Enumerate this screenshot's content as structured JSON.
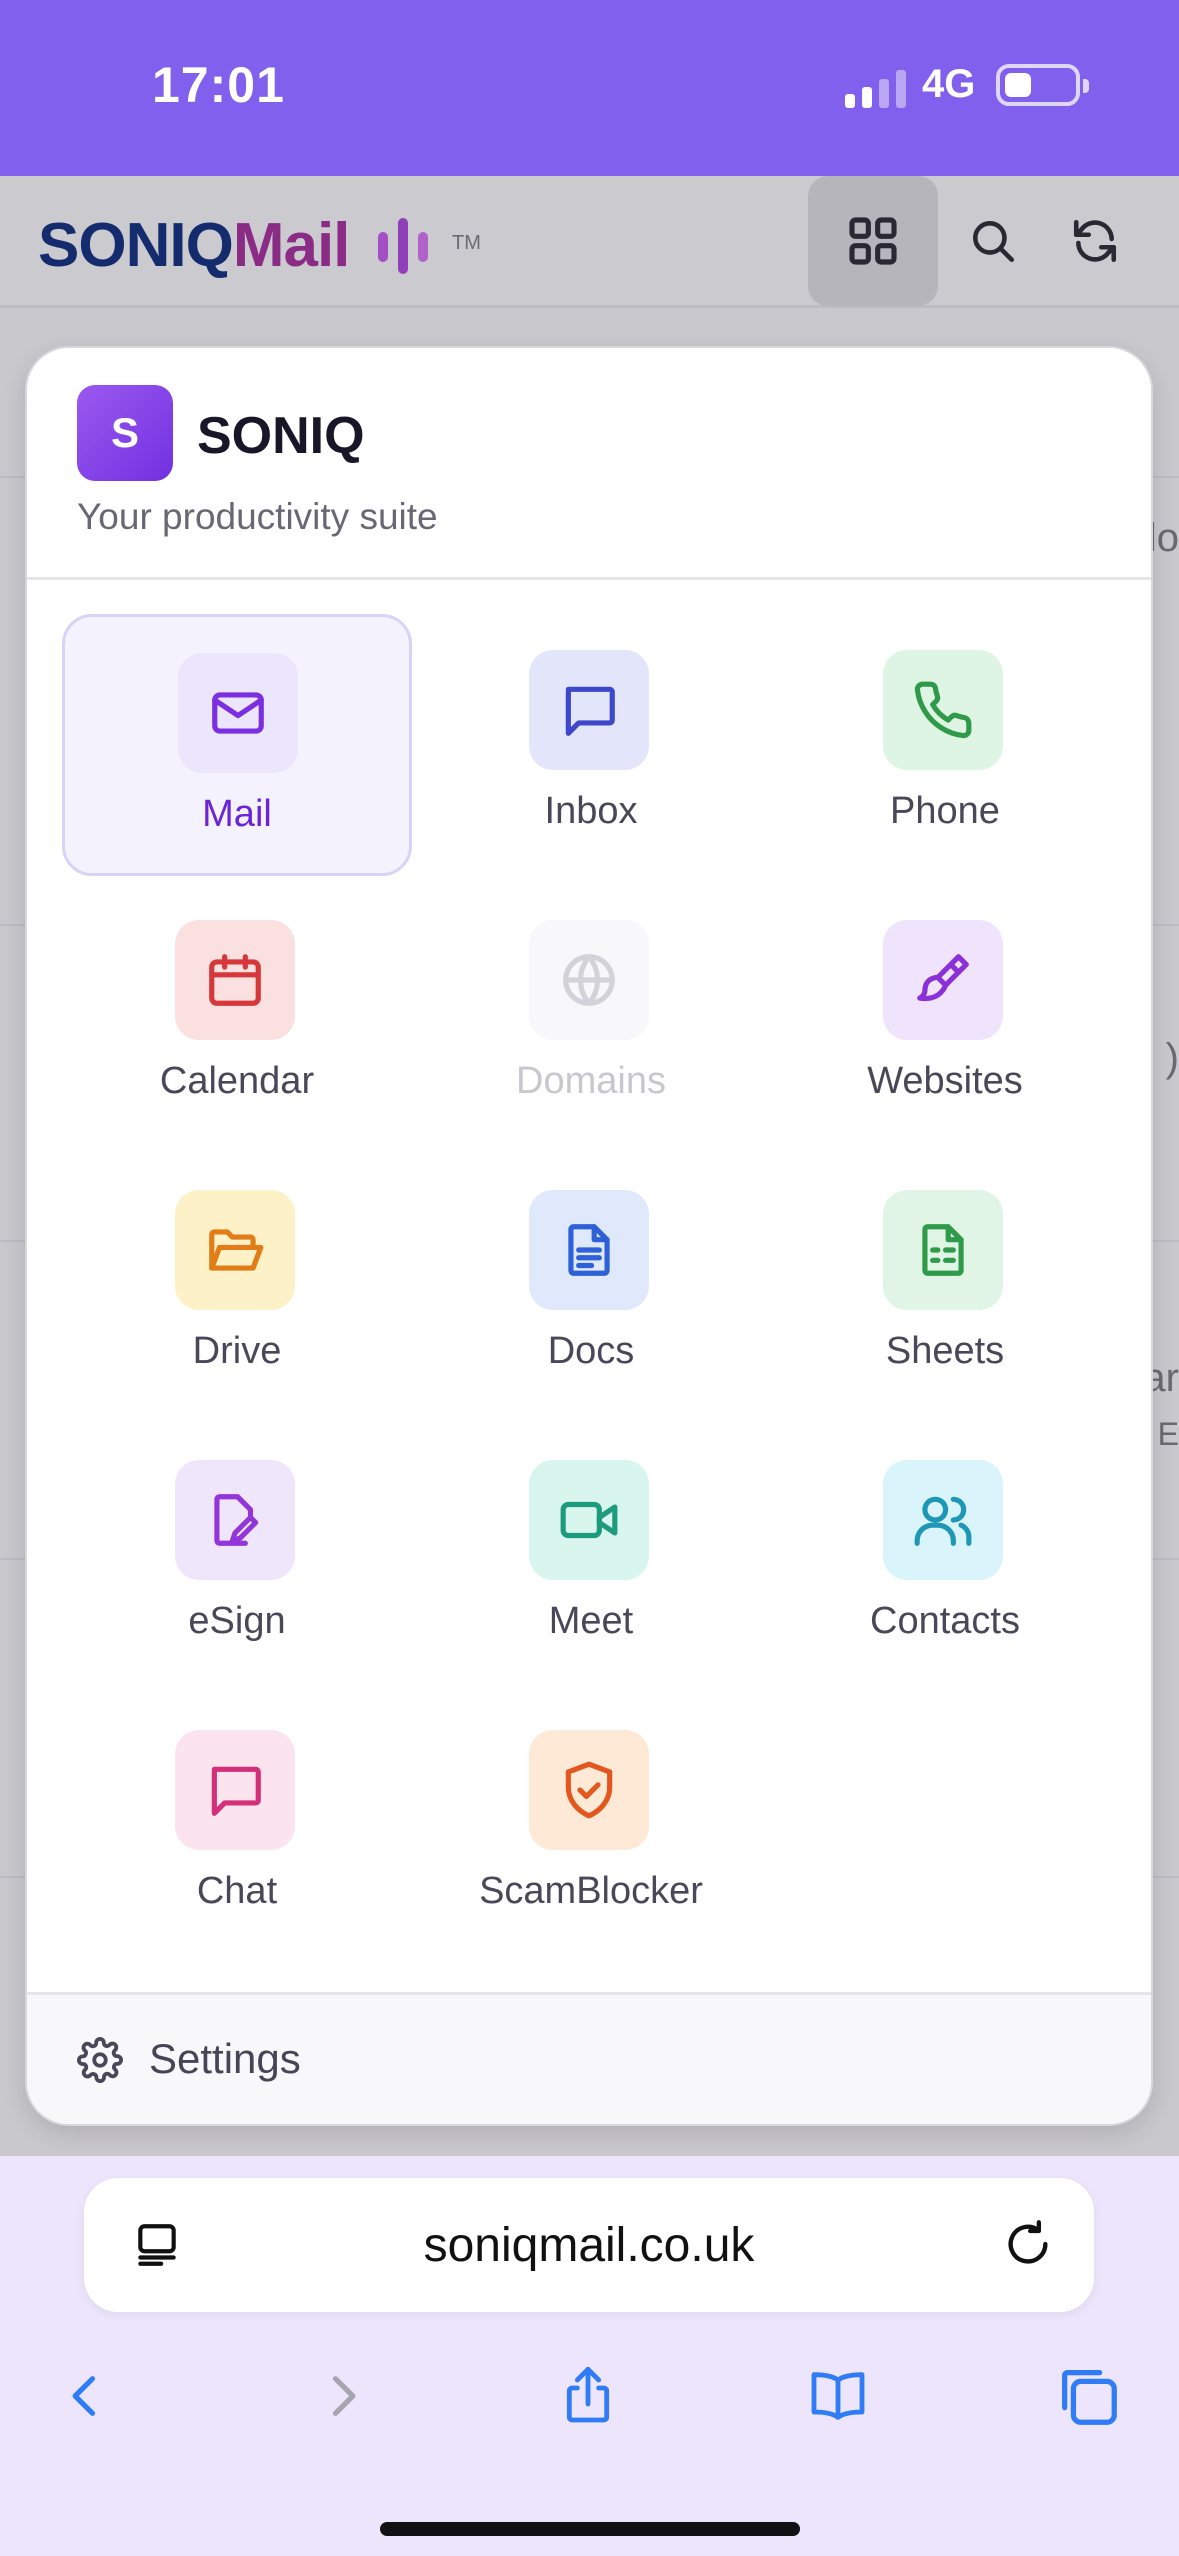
{
  "status_bar": {
    "time": "17:01",
    "network": "4G"
  },
  "app_header": {
    "logo_part1": "SONIQ",
    "logo_part2": "Mail",
    "trademark": "TM"
  },
  "background_fragments": [
    "lo",
    ")",
    "ar",
    "r E"
  ],
  "switcher": {
    "brand_initial": "S",
    "brand_name": "SONIQ",
    "subtitle": "Your productivity suite",
    "apps": [
      {
        "label": "Mail",
        "icon": "mail-icon",
        "bg": "#ebe6fb",
        "fg": "#7b2fe0",
        "state": "active"
      },
      {
        "label": "Inbox",
        "icon": "message-square-icon",
        "bg": "#e3e6fb",
        "fg": "#3d47c9",
        "state": "normal"
      },
      {
        "label": "Phone",
        "icon": "phone-icon",
        "bg": "#dff5e4",
        "fg": "#2f9a4a",
        "state": "normal"
      },
      {
        "label": "Calendar",
        "icon": "calendar-icon",
        "bg": "#fbe0e0",
        "fg": "#d6373b",
        "state": "normal"
      },
      {
        "label": "Domains",
        "icon": "globe-icon",
        "bg": "#f8f8fa",
        "fg": "#d3d2d9",
        "state": "disabled"
      },
      {
        "label": "Websites",
        "icon": "paintbrush-icon",
        "bg": "#efe4fb",
        "fg": "#8b2fd9",
        "state": "normal"
      },
      {
        "label": "Drive",
        "icon": "folder-open-icon",
        "bg": "#fdf1c7",
        "fg": "#e17c16",
        "state": "normal"
      },
      {
        "label": "Docs",
        "icon": "document-icon",
        "bg": "#e0e9fb",
        "fg": "#2e61d8",
        "state": "normal"
      },
      {
        "label": "Sheets",
        "icon": "spreadsheet-icon",
        "bg": "#e0f5e6",
        "fg": "#2f9a4a",
        "state": "normal"
      },
      {
        "label": "eSign",
        "icon": "file-signature-icon",
        "bg": "#f0e6fb",
        "fg": "#9336d9",
        "state": "normal"
      },
      {
        "label": "Meet",
        "icon": "video-icon",
        "bg": "#d9f6ee",
        "fg": "#1e9b7c",
        "state": "normal"
      },
      {
        "label": "Contacts",
        "icon": "users-icon",
        "bg": "#d9f4fb",
        "fg": "#1d97b5",
        "state": "normal"
      },
      {
        "label": "Chat",
        "icon": "chat-icon",
        "bg": "#fbe4ee",
        "fg": "#d42f7a",
        "state": "normal"
      },
      {
        "label": "ScamBlocker",
        "icon": "shield-check-icon",
        "bg": "#fde9d6",
        "fg": "#e3571f",
        "state": "normal"
      }
    ],
    "settings_label": "Settings"
  },
  "browser": {
    "url": "soniqmail.co.uk"
  },
  "colors": {
    "status_bar": "#8060ec",
    "brand_gradient_start": "#9c59f0",
    "brand_gradient_end": "#7131e0"
  }
}
